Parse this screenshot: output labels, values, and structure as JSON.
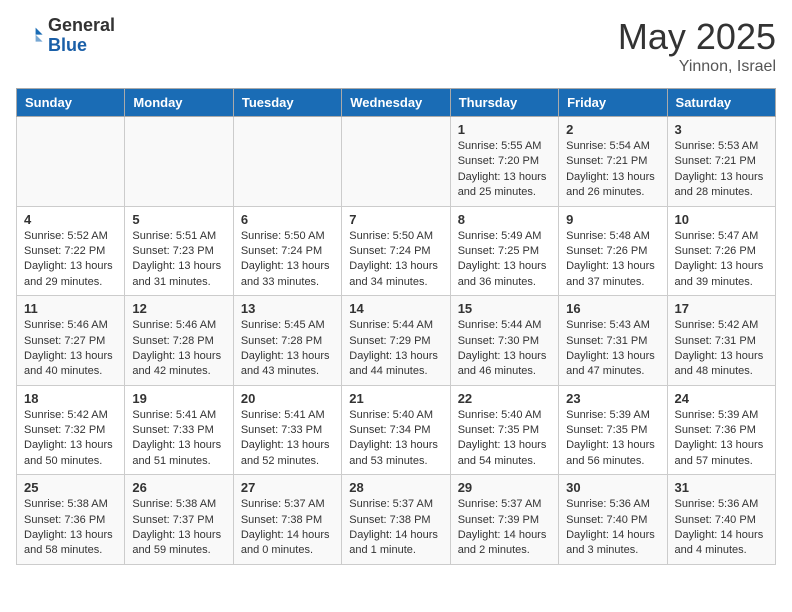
{
  "header": {
    "logo_general": "General",
    "logo_blue": "Blue",
    "month_year": "May 2025",
    "location": "Yinnon, Israel"
  },
  "days_of_week": [
    "Sunday",
    "Monday",
    "Tuesday",
    "Wednesday",
    "Thursday",
    "Friday",
    "Saturday"
  ],
  "weeks": [
    [
      {
        "date": "",
        "info": ""
      },
      {
        "date": "",
        "info": ""
      },
      {
        "date": "",
        "info": ""
      },
      {
        "date": "",
        "info": ""
      },
      {
        "date": "1",
        "info": "Sunrise: 5:55 AM\nSunset: 7:20 PM\nDaylight: 13 hours\nand 25 minutes."
      },
      {
        "date": "2",
        "info": "Sunrise: 5:54 AM\nSunset: 7:21 PM\nDaylight: 13 hours\nand 26 minutes."
      },
      {
        "date": "3",
        "info": "Sunrise: 5:53 AM\nSunset: 7:21 PM\nDaylight: 13 hours\nand 28 minutes."
      }
    ],
    [
      {
        "date": "4",
        "info": "Sunrise: 5:52 AM\nSunset: 7:22 PM\nDaylight: 13 hours\nand 29 minutes."
      },
      {
        "date": "5",
        "info": "Sunrise: 5:51 AM\nSunset: 7:23 PM\nDaylight: 13 hours\nand 31 minutes."
      },
      {
        "date": "6",
        "info": "Sunrise: 5:50 AM\nSunset: 7:24 PM\nDaylight: 13 hours\nand 33 minutes."
      },
      {
        "date": "7",
        "info": "Sunrise: 5:50 AM\nSunset: 7:24 PM\nDaylight: 13 hours\nand 34 minutes."
      },
      {
        "date": "8",
        "info": "Sunrise: 5:49 AM\nSunset: 7:25 PM\nDaylight: 13 hours\nand 36 minutes."
      },
      {
        "date": "9",
        "info": "Sunrise: 5:48 AM\nSunset: 7:26 PM\nDaylight: 13 hours\nand 37 minutes."
      },
      {
        "date": "10",
        "info": "Sunrise: 5:47 AM\nSunset: 7:26 PM\nDaylight: 13 hours\nand 39 minutes."
      }
    ],
    [
      {
        "date": "11",
        "info": "Sunrise: 5:46 AM\nSunset: 7:27 PM\nDaylight: 13 hours\nand 40 minutes."
      },
      {
        "date": "12",
        "info": "Sunrise: 5:46 AM\nSunset: 7:28 PM\nDaylight: 13 hours\nand 42 minutes."
      },
      {
        "date": "13",
        "info": "Sunrise: 5:45 AM\nSunset: 7:28 PM\nDaylight: 13 hours\nand 43 minutes."
      },
      {
        "date": "14",
        "info": "Sunrise: 5:44 AM\nSunset: 7:29 PM\nDaylight: 13 hours\nand 44 minutes."
      },
      {
        "date": "15",
        "info": "Sunrise: 5:44 AM\nSunset: 7:30 PM\nDaylight: 13 hours\nand 46 minutes."
      },
      {
        "date": "16",
        "info": "Sunrise: 5:43 AM\nSunset: 7:31 PM\nDaylight: 13 hours\nand 47 minutes."
      },
      {
        "date": "17",
        "info": "Sunrise: 5:42 AM\nSunset: 7:31 PM\nDaylight: 13 hours\nand 48 minutes."
      }
    ],
    [
      {
        "date": "18",
        "info": "Sunrise: 5:42 AM\nSunset: 7:32 PM\nDaylight: 13 hours\nand 50 minutes."
      },
      {
        "date": "19",
        "info": "Sunrise: 5:41 AM\nSunset: 7:33 PM\nDaylight: 13 hours\nand 51 minutes."
      },
      {
        "date": "20",
        "info": "Sunrise: 5:41 AM\nSunset: 7:33 PM\nDaylight: 13 hours\nand 52 minutes."
      },
      {
        "date": "21",
        "info": "Sunrise: 5:40 AM\nSunset: 7:34 PM\nDaylight: 13 hours\nand 53 minutes."
      },
      {
        "date": "22",
        "info": "Sunrise: 5:40 AM\nSunset: 7:35 PM\nDaylight: 13 hours\nand 54 minutes."
      },
      {
        "date": "23",
        "info": "Sunrise: 5:39 AM\nSunset: 7:35 PM\nDaylight: 13 hours\nand 56 minutes."
      },
      {
        "date": "24",
        "info": "Sunrise: 5:39 AM\nSunset: 7:36 PM\nDaylight: 13 hours\nand 57 minutes."
      }
    ],
    [
      {
        "date": "25",
        "info": "Sunrise: 5:38 AM\nSunset: 7:36 PM\nDaylight: 13 hours\nand 58 minutes."
      },
      {
        "date": "26",
        "info": "Sunrise: 5:38 AM\nSunset: 7:37 PM\nDaylight: 13 hours\nand 59 minutes."
      },
      {
        "date": "27",
        "info": "Sunrise: 5:37 AM\nSunset: 7:38 PM\nDaylight: 14 hours\nand 0 minutes."
      },
      {
        "date": "28",
        "info": "Sunrise: 5:37 AM\nSunset: 7:38 PM\nDaylight: 14 hours\nand 1 minute."
      },
      {
        "date": "29",
        "info": "Sunrise: 5:37 AM\nSunset: 7:39 PM\nDaylight: 14 hours\nand 2 minutes."
      },
      {
        "date": "30",
        "info": "Sunrise: 5:36 AM\nSunset: 7:40 PM\nDaylight: 14 hours\nand 3 minutes."
      },
      {
        "date": "31",
        "info": "Sunrise: 5:36 AM\nSunset: 7:40 PM\nDaylight: 14 hours\nand 4 minutes."
      }
    ]
  ]
}
